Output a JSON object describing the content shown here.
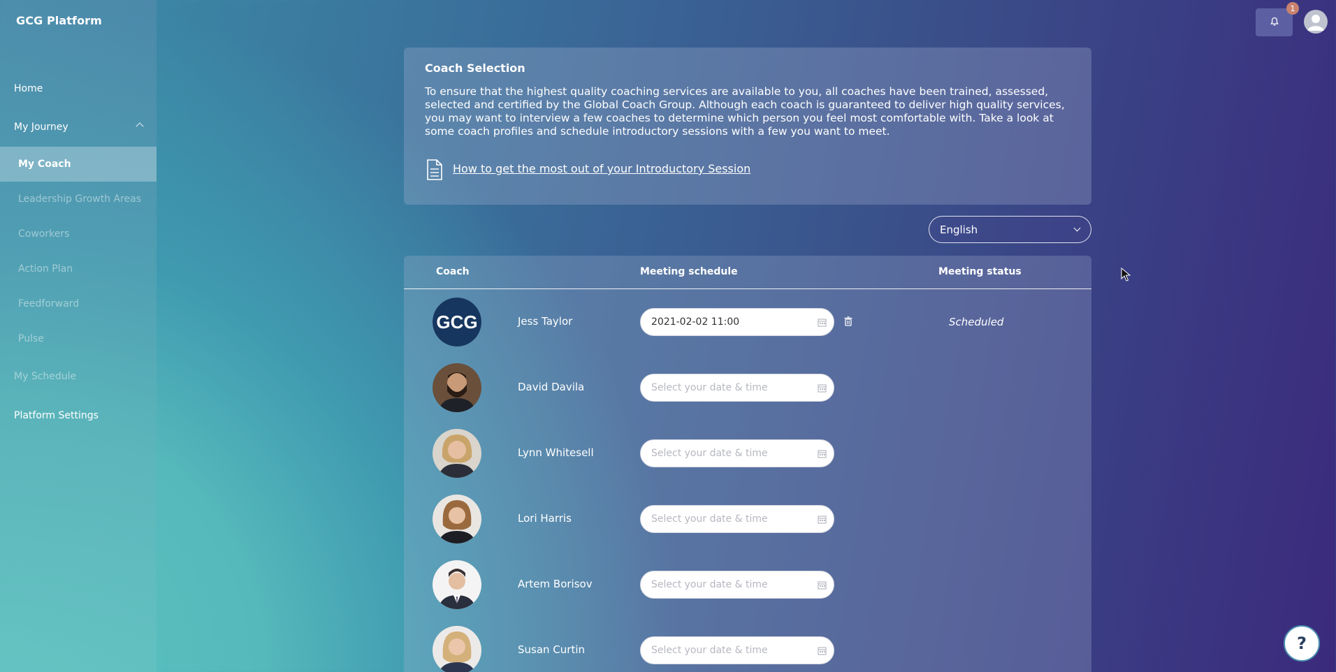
{
  "app": {
    "title": "GCG Platform"
  },
  "sidebar": {
    "items": [
      {
        "label": "Home"
      },
      {
        "label": "My Journey"
      },
      {
        "label": "My Coach"
      },
      {
        "label": "Leadership Growth Areas"
      },
      {
        "label": "Coworkers"
      },
      {
        "label": "Action Plan"
      },
      {
        "label": "Feedforward"
      },
      {
        "label": "Pulse"
      },
      {
        "label": "My Schedule"
      },
      {
        "label": "Platform Settings"
      }
    ]
  },
  "header": {
    "notification_count": "1"
  },
  "intro": {
    "title": "Coach Selection",
    "text": "To ensure that the highest quality coaching services are available to you, all coaches have been trained, assessed, selected and certified by the Global Coach Group. Although each coach is guaranteed to deliver high quality services, you may want to interview a few coaches to determine which person you feel most comfortable with. Take a look at some coach profiles and schedule introductory sessions with a few you want to meet.",
    "link": "How to get the most out of your Introductory Session"
  },
  "language": {
    "selected": "English"
  },
  "table": {
    "headers": {
      "coach": "Coach",
      "schedule": "Meeting schedule",
      "status": "Meeting status"
    },
    "placeholder": "Select your date & time",
    "rows": [
      {
        "name": "Jess Taylor",
        "date": "2021-02-02 11:00",
        "status": "Scheduled",
        "logo": "GCG"
      },
      {
        "name": "David Davila",
        "date": "",
        "status": ""
      },
      {
        "name": "Lynn Whitesell",
        "date": "",
        "status": ""
      },
      {
        "name": "Lori Harris",
        "date": "",
        "status": ""
      },
      {
        "name": "Artem Borisov",
        "date": "",
        "status": ""
      },
      {
        "name": "Susan Curtin",
        "date": "",
        "status": ""
      }
    ]
  },
  "help": {
    "label": "?"
  },
  "colors": {
    "accent": "#3b2a7c",
    "teal": "#5ec4c0",
    "badge": "#c8826f"
  }
}
